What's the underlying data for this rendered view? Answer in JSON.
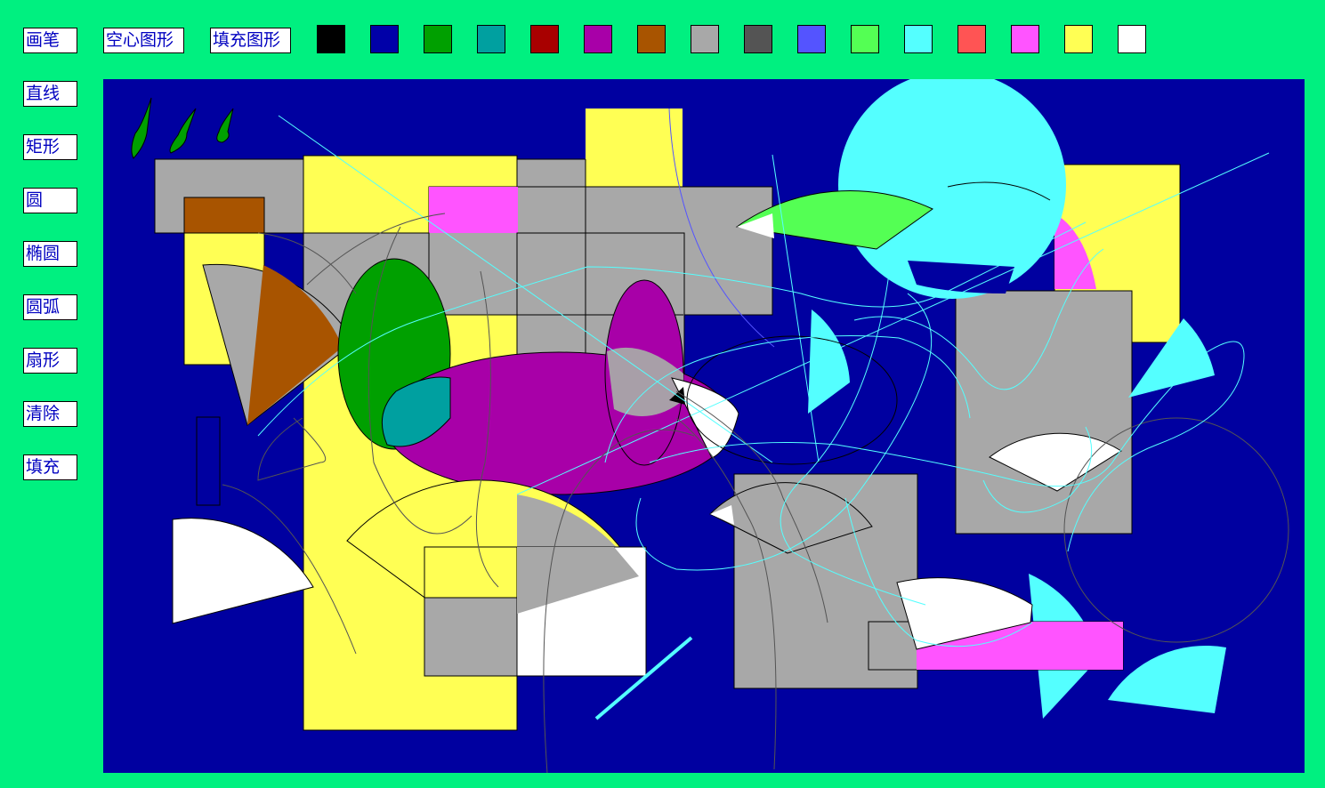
{
  "top_toolbar": {
    "pen_label": "画笔",
    "outline_label": "空心图形",
    "fill_label": "填充图形"
  },
  "palette": [
    {
      "name": "black",
      "color": "#000000"
    },
    {
      "name": "navy",
      "color": "#0000a8"
    },
    {
      "name": "green",
      "color": "#00a000"
    },
    {
      "name": "teal",
      "color": "#00a0a0"
    },
    {
      "name": "dark-red",
      "color": "#a80000"
    },
    {
      "name": "purple",
      "color": "#a800a8"
    },
    {
      "name": "brown",
      "color": "#a85400"
    },
    {
      "name": "light-gray",
      "color": "#a8a8a8"
    },
    {
      "name": "dark-gray",
      "color": "#545454"
    },
    {
      "name": "light-blue",
      "color": "#5454ff"
    },
    {
      "name": "light-green",
      "color": "#54ff54"
    },
    {
      "name": "light-cyan",
      "color": "#54ffff"
    },
    {
      "name": "light-red",
      "color": "#ff5454"
    },
    {
      "name": "light-magenta",
      "color": "#ff54ff"
    },
    {
      "name": "yellow",
      "color": "#ffff54"
    },
    {
      "name": "white",
      "color": "#ffffff"
    }
  ],
  "side_toolbar": {
    "line_label": "直线",
    "rect_label": "矩形",
    "circle_label": "圆",
    "ellipse_label": "椭圆",
    "arc_label": "圆弧",
    "sector_label": "扇形",
    "clear_label": "清除",
    "fill_label": "填充"
  },
  "colors": {
    "background": "#00f080",
    "canvas": "#0000a0",
    "button_text": "#0000c0"
  }
}
